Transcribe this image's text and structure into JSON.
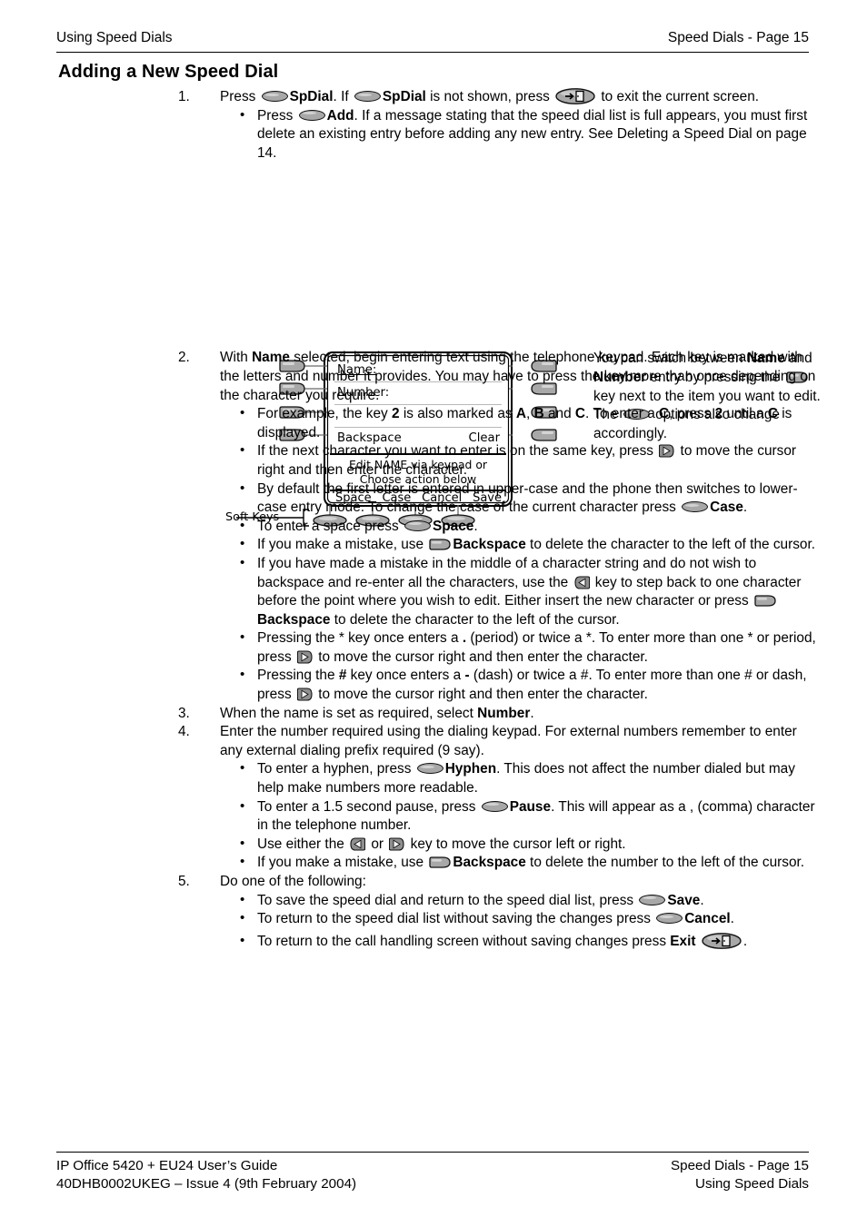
{
  "header": {
    "left": "Using Speed Dials",
    "right": "Speed Dials - Page 15"
  },
  "title": "Adding a New Speed Dial",
  "steps": [
    {
      "num": "1.",
      "text_a": "Press ",
      "bold_a": "SpDial",
      "text_b": ". If ",
      "bold_b": "SpDial",
      "text_c": " is not shown, press ",
      "text_d": " to exit the current screen.",
      "bullets": [
        {
          "text_a": "Press ",
          "bold_a": "Add",
          "text_b": ". If a message stating that the speed dial list is full appears, you must first delete an existing entry before adding any new entry. See Deleting a Speed Dial on page 14."
        }
      ]
    },
    {
      "num": "2.",
      "text_a": "With ",
      "bold_a": "Name",
      "text_b": " selected, begin entering text using the telephone keypad. Each key is marked with the letters and number it provides. You may have to press the key more than once depending on the character you require."
    },
    {
      "num": "3.",
      "text_a": "When the name is set as required, select ",
      "bold_a": "Number",
      "text_b": "."
    },
    {
      "num": "4.",
      "text_a": "Enter the number required using the dialing keypad. For external numbers remember to enter any external dialing prefix required (9 say)."
    },
    {
      "num": "5.",
      "text_a": "Do one of the following:"
    }
  ],
  "step2_bullets": {
    "b1_a": "For example, the key ",
    "b1_k": "2",
    "b1_b": " is also marked as ",
    "b1_A": "A",
    "b1_c": ", ",
    "b1_B": "B",
    "b1_d": " and ",
    "b1_C": "C",
    "b1_e": ". To enter a ",
    "b1_C2": "C",
    "b1_f": ", press ",
    "b1_k2": "2",
    "b1_g": " until a ",
    "b1_C3": "C",
    "b1_h": " is displayed.",
    "b2_a": "If the next character you want to enter is on the same key, press ",
    "b2_b": " to move the cursor right and then enter the character.",
    "b3_a": "By default the first letter is entered in upper-case and the phone then switches to lower-case entry mode. To change the case of the current character press ",
    "b3_bold": "Case",
    "b3_b": ".",
    "b4_a": "To enter a space press ",
    "b4_bold": "Space",
    "b4_b": ".",
    "b5_a": "If you make a mistake, use ",
    "b5_bold": "Backspace",
    "b5_b": " to delete the character to the left of the cursor.",
    "b6_a": "If you have made a mistake in the middle of a character string and do not wish to backspace and re-enter all the characters, use the ",
    "b6_b": " key to step back to one character before the point where you wish to edit. Either insert the new character or press ",
    "b6_bold": "Backspace",
    "b6_c": " to delete the character to the left of the cursor.",
    "b7_a": "Pressing the * key once enters a ",
    "b7_dot": ".",
    "b7_b": " (period) or twice a *. To enter more than one * or period, press ",
    "b7_c": " to move the cursor right and then enter the character.",
    "b8_a": "Pressing the ",
    "b8_hash": "#",
    "b8_b": " key once enters a ",
    "b8_dash": "-",
    "b8_c": " (dash) or twice a #. To enter more than one # or dash, press ",
    "b8_d": " to move the cursor right and then enter the character."
  },
  "step4_bullets": {
    "b1_a": "To enter a hyphen, press ",
    "b1_bold": "Hyphen",
    "b1_b": ". This does not affect the number dialed but may help make numbers more readable.",
    "b2_a": "To enter a 1.5 second pause, press ",
    "b2_bold": "Pause",
    "b2_b": ". This will appear as a , (comma) character in the telephone number.",
    "b3_a": "Use either the ",
    "b3_b": " or ",
    "b3_c": " key to move the cursor left or right.",
    "b4_a": "If you make a mistake, use ",
    "b4_bold": "Backspace",
    "b4_b": " to delete the number to the left of the cursor."
  },
  "step5_bullets": {
    "b1_a": "To save the speed dial and return to the speed dial list, press ",
    "b1_bold": "Save",
    "b1_b": ".",
    "b2_a": "To return to the speed dial list without saving the changes press ",
    "b2_bold": "Cancel",
    "b2_b": ".",
    "b3_a": "To return to the call handling screen without saving changes press ",
    "b3_bold": "Exit",
    "b3_b": "."
  },
  "diagram": {
    "rows": [
      {
        "label": "Name:",
        "right": "",
        "selected": true
      },
      {
        "label": "Number:",
        "right": "",
        "selected": false
      },
      {
        "label": "",
        "right": "",
        "selected": false
      },
      {
        "label": "Backspace",
        "right": "Clear",
        "selected": false
      }
    ],
    "message_line1": "Edit NAME via keypad or",
    "message_line2": "Choose action below",
    "softkeys": [
      "Space",
      "Case",
      "Cancel",
      "Save"
    ],
    "softkeys_label": "Soft Keys"
  },
  "sidenote": {
    "a": "You can switch between ",
    "bold_name": "Name",
    "b": " and ",
    "bold_number": "Number",
    "c": " entry by pressing the ",
    "d": " key next to the item you want to edit. The ",
    "e": " options also change accordingly."
  },
  "footer": {
    "left_line1": "IP Office 5420 + EU24 User’s Guide",
    "left_line2": "40DHB0002UKEG – Issue 4 (9th February 2004)",
    "right_line1": "Speed Dials - Page 15",
    "right_line2": "Using Speed Dials"
  },
  "colors": {
    "key_fill": "#a8a8a8",
    "key_stroke": "#111111",
    "rule": "#000000"
  }
}
